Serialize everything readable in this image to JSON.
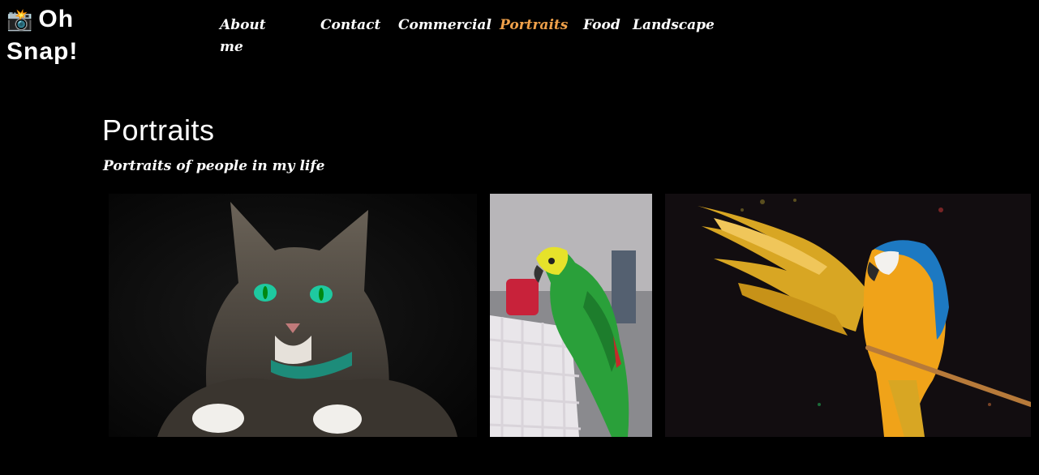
{
  "site": {
    "logo_icon": "📸",
    "logo_line1": "Oh",
    "logo_line2": "Snap!"
  },
  "nav": {
    "items": [
      {
        "label": "About me"
      },
      {
        "label": "Contact"
      },
      {
        "label": "Commercial"
      },
      {
        "label": "Portraits"
      },
      {
        "label": "Food"
      },
      {
        "label": "Landscape"
      }
    ],
    "active_color": "#f0a14a"
  },
  "page": {
    "title": "Portraits",
    "subtitle": "Portraits of people in my life"
  },
  "gallery": [
    {
      "icon": "cat-photo"
    },
    {
      "icon": "green-parrot-photo"
    },
    {
      "icon": "macaw-photo"
    }
  ]
}
